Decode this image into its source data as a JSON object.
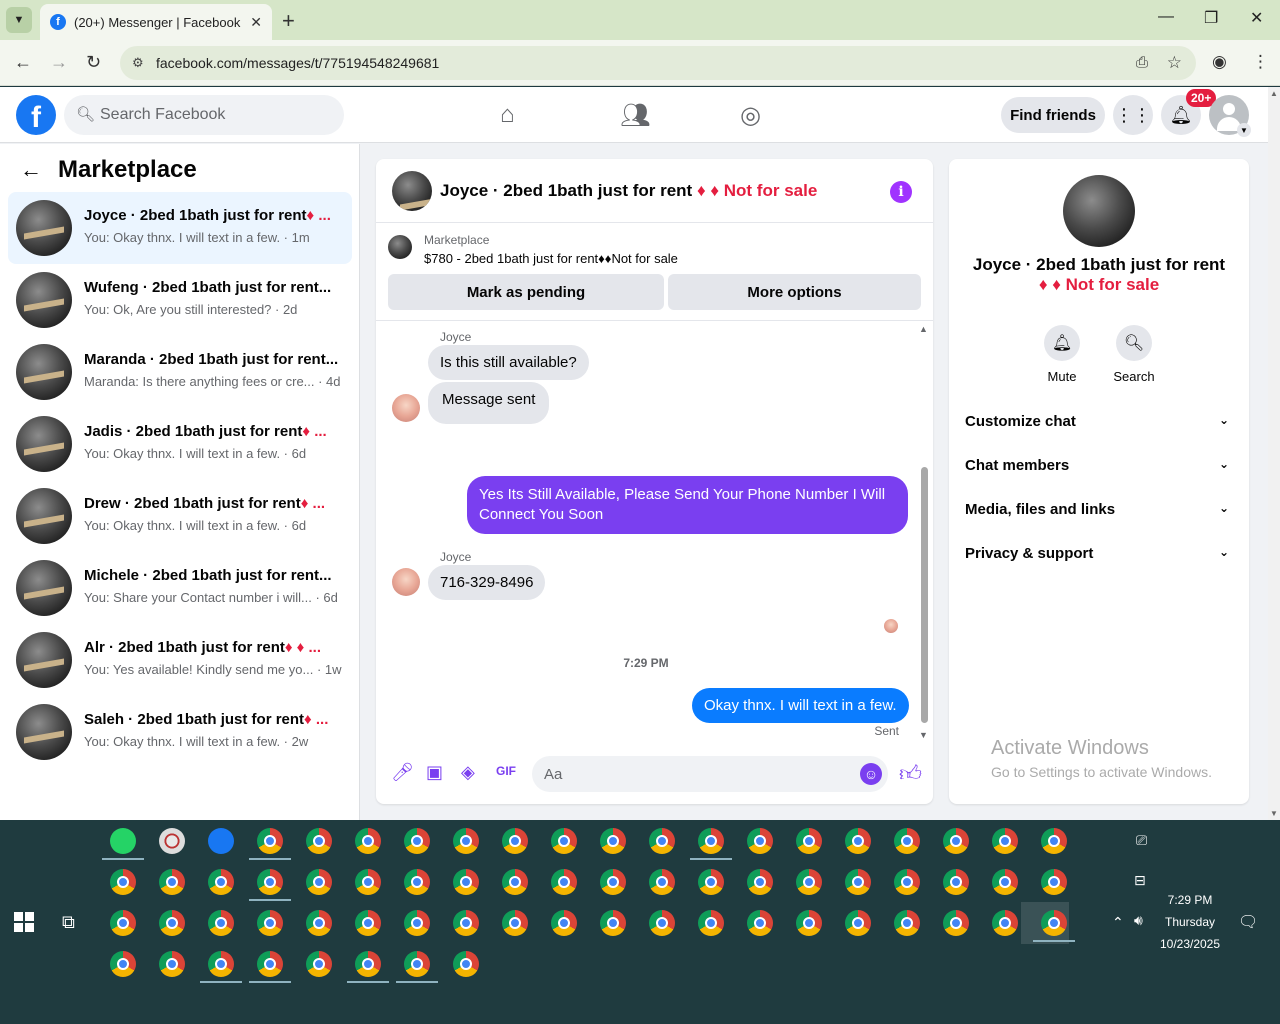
{
  "browser": {
    "tab_title": "(20+) Messenger | Facebook",
    "url": "facebook.com/messages/t/775194548249681"
  },
  "fb": {
    "search_placeholder": "Search Facebook",
    "find_friends": "Find friends",
    "notif_badge": "20+"
  },
  "sidebar": {
    "title": "Marketplace",
    "conversations": [
      {
        "name": "Joyce · 2bed 1bath just for rent",
        "suffix": "♦ ...",
        "snippet": "You: Okay thnx. I will text in a few. · 1m",
        "active": true
      },
      {
        "name": "Wufeng · 2bed 1bath just for rent...",
        "suffix": "",
        "snippet": "You: Ok, Are you still interested? · 2d"
      },
      {
        "name": "Maranda · 2bed 1bath just for rent...",
        "suffix": "",
        "snippet": "Maranda: Is there anything fees or cre... · 4d"
      },
      {
        "name": "Jadis · 2bed 1bath just for rent",
        "suffix": "♦ ...",
        "snippet": "You: Okay thnx. I will text in a few. · 6d"
      },
      {
        "name": "Drew · 2bed 1bath just for rent",
        "suffix": "♦ ...",
        "snippet": "You: Okay thnx. I will text in a few. · 6d"
      },
      {
        "name": "Michele · 2bed 1bath just for rent...",
        "suffix": "",
        "snippet": "You: Share your Contact number i will... · 6d"
      },
      {
        "name": "Alr · 2bed 1bath just for rent",
        "suffix": "♦ ♦ ...",
        "snippet": "You: Yes available! Kindly send me yo... · 1w"
      },
      {
        "name": "Saleh · 2bed 1bath just for rent",
        "suffix": "♦ ...",
        "snippet": "You: Okay thnx. I will text in a few. · 2w"
      }
    ]
  },
  "chat": {
    "title": "Joyce · 2bed 1bath just for rent",
    "title_suffix": "♦ ♦ Not for sale",
    "listing_label": "Marketplace",
    "listing_price": "$780 - 2bed 1bath just for rent♦♦Not for sale",
    "btn_pending": "Mark as pending",
    "btn_more": "More options",
    "sender1": "Joyce",
    "msg1": "Is this still available?",
    "msg2": "Message sent",
    "msg3": "Yes Its Still Available, Please Send Your Phone Number I Will Connect You Soon",
    "sender2": "Joyce",
    "msg4": "716-329-8496",
    "time": "7:29 PM",
    "msg5": "Okay thnx. I will text in a few.",
    "status": "Sent",
    "composer_placeholder": "Aa"
  },
  "details": {
    "name_line1": "Joyce · 2bed 1bath just for rent",
    "name_line2": "♦ ♦ Not for sale",
    "mute": "Mute",
    "search": "Search",
    "sections": [
      "Customize chat",
      "Chat members",
      "Media, files and links",
      "Privacy & support"
    ]
  },
  "watermark": {
    "line1": "Activate Windows",
    "line2": "Go to Settings to activate Windows."
  },
  "clock": {
    "time": "7:29 PM",
    "day": "Thursday",
    "date": "10/23/2025"
  }
}
